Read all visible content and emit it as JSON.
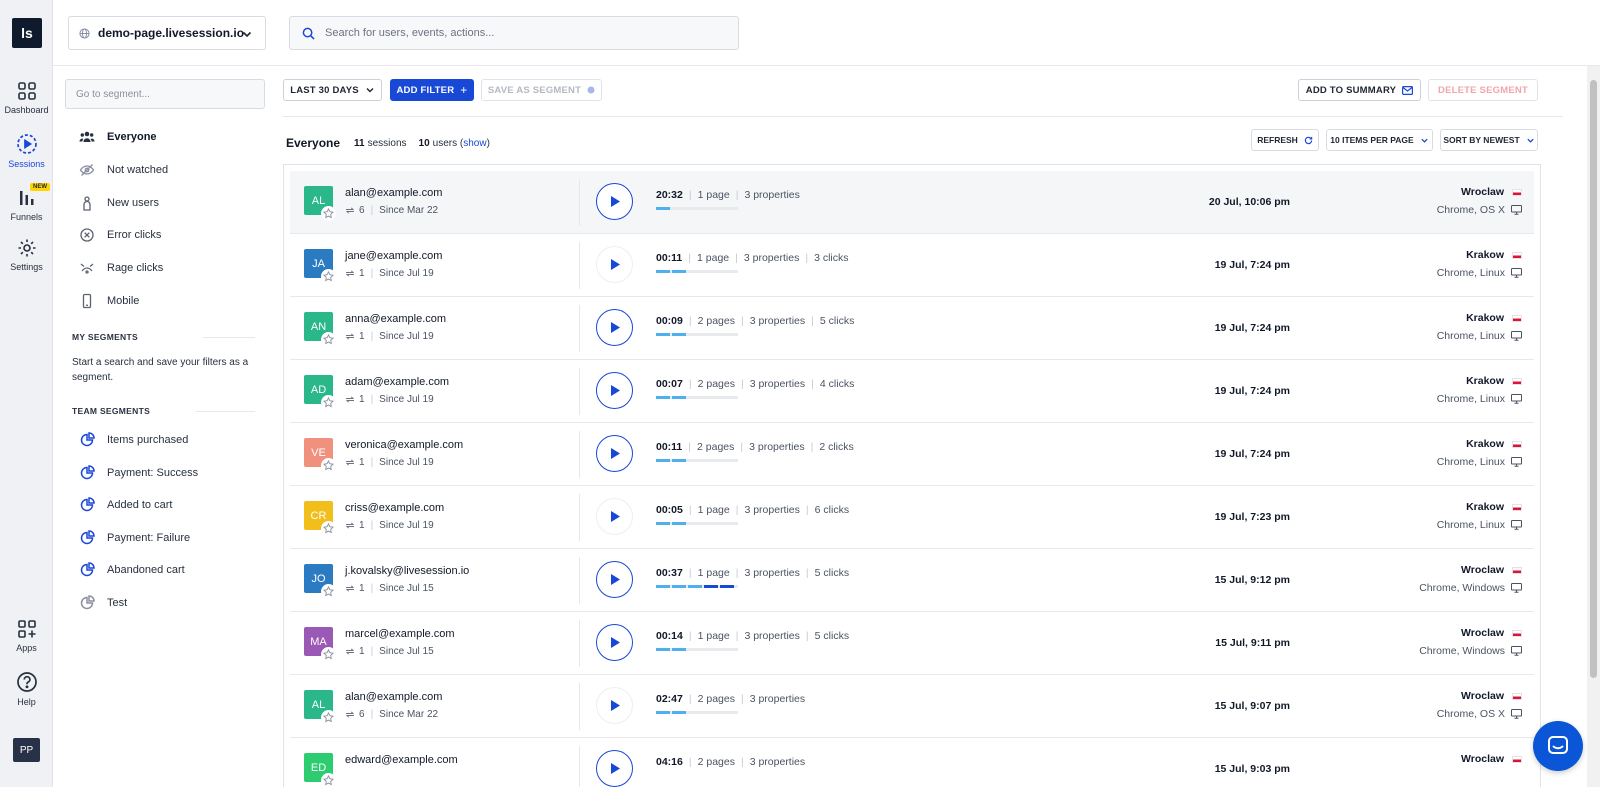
{
  "app": {
    "logo": "ls",
    "avatar_initials": "PP"
  },
  "rail": [
    {
      "label": "Dashboard",
      "icon": "grid-icon"
    },
    {
      "label": "Sessions",
      "icon": "play-circle-icon",
      "active": true
    },
    {
      "label": "Funnels",
      "icon": "bar-chart-icon",
      "badge": "NEW"
    },
    {
      "label": "Settings",
      "icon": "gear-icon"
    },
    {
      "label": "Apps",
      "icon": "apps-plus-icon"
    },
    {
      "label": "Help",
      "icon": "help-icon"
    }
  ],
  "header": {
    "site": "demo-page.livesession.io",
    "search_placeholder": "Search for users, events, actions..."
  },
  "segments": {
    "search_placeholder": "Go to segment...",
    "default": [
      {
        "label": "Everyone",
        "icon": "users-icon"
      },
      {
        "label": "Not watched",
        "icon": "eye-off-icon"
      },
      {
        "label": "New users",
        "icon": "new-user-icon"
      },
      {
        "label": "Error clicks",
        "icon": "error-icon"
      },
      {
        "label": "Rage clicks",
        "icon": "rage-icon"
      },
      {
        "label": "Mobile",
        "icon": "mobile-icon"
      }
    ],
    "my_title": "MY SEGMENTS",
    "my_empty": "Start a search and save your filters as a segment.",
    "team_title": "TEAM SEGMENTS",
    "team": [
      {
        "label": "Items purchased"
      },
      {
        "label": "Payment: Success"
      },
      {
        "label": "Added to cart"
      },
      {
        "label": "Payment: Failure"
      },
      {
        "label": "Abandoned cart"
      },
      {
        "label": "Test"
      }
    ]
  },
  "toolbar": {
    "range": "LAST 30 DAYS",
    "add_filter": "ADD FILTER",
    "save_segment": "SAVE AS SEGMENT",
    "add_summary": "ADD TO SUMMARY",
    "delete_segment": "DELETE SEGMENT"
  },
  "list": {
    "segment": "Everyone",
    "sessions_count": "11",
    "sessions_label": "sessions",
    "users_count": "10",
    "users_label": "users",
    "show": "show",
    "refresh": "REFRESH",
    "per_page": "10 ITEMS PER PAGE",
    "sort": "SORT BY NEWEST"
  },
  "colors": {
    "accent": "#1748d6",
    "progress": "#4fb0f0"
  },
  "sessions": [
    {
      "initials": "AL",
      "color": "#2ab78a",
      "email": "alan@example.com",
      "visits": "6",
      "since": "Since Mar 22",
      "duration": "20:32",
      "pages": "1 page",
      "props": "3 properties",
      "clicks": "",
      "bar": 1,
      "bar_dark": 0,
      "date": "20 Jul, 10:06 pm",
      "city": "Wroclaw",
      "env": "Chrome, OS X",
      "highlight": true
    },
    {
      "initials": "JA",
      "color": "#2b7bc3",
      "email": "jane@example.com",
      "visits": "1",
      "since": "Since Jul 19",
      "duration": "00:11",
      "pages": "1 page",
      "props": "3 properties",
      "clicks": "3 clicks",
      "bar": 2,
      "bar_dark": 0,
      "date": "19 Jul, 7:24 pm",
      "city": "Krakow",
      "env": "Chrome, Linux",
      "light": true
    },
    {
      "initials": "AN",
      "color": "#2ab78a",
      "email": "anna@example.com",
      "visits": "1",
      "since": "Since Jul 19",
      "duration": "00:09",
      "pages": "2 pages",
      "props": "3 properties",
      "clicks": "5 clicks",
      "bar": 2,
      "bar_dark": 0,
      "date": "19 Jul, 7:24 pm",
      "city": "Krakow",
      "env": "Chrome, Linux"
    },
    {
      "initials": "AD",
      "color": "#2ab78a",
      "email": "adam@example.com",
      "visits": "1",
      "since": "Since Jul 19",
      "duration": "00:07",
      "pages": "2 pages",
      "props": "3 properties",
      "clicks": "4 clicks",
      "bar": 2,
      "bar_dark": 0,
      "date": "19 Jul, 7:24 pm",
      "city": "Krakow",
      "env": "Chrome, Linux"
    },
    {
      "initials": "VE",
      "color": "#f0917e",
      "email": "veronica@example.com",
      "visits": "1",
      "since": "Since Jul 19",
      "duration": "00:11",
      "pages": "2 pages",
      "props": "3 properties",
      "clicks": "2 clicks",
      "bar": 2,
      "bar_dark": 0,
      "date": "19 Jul, 7:24 pm",
      "city": "Krakow",
      "env": "Chrome, Linux"
    },
    {
      "initials": "CR",
      "color": "#f2be1c",
      "email": "criss@example.com",
      "visits": "1",
      "since": "Since Jul 19",
      "duration": "00:05",
      "pages": "1 page",
      "props": "3 properties",
      "clicks": "6 clicks",
      "bar": 2,
      "bar_dark": 0,
      "date": "19 Jul, 7:23 pm",
      "city": "Krakow",
      "env": "Chrome, Linux",
      "light": true
    },
    {
      "initials": "JO",
      "color": "#2b7bc3",
      "email": "j.kovalsky@livesession.io",
      "visits": "1",
      "since": "Since Jul 15",
      "duration": "00:37",
      "pages": "1 page",
      "props": "3 properties",
      "clicks": "5 clicks",
      "bar": 3,
      "bar_dark": 2,
      "date": "15 Jul, 9:12 pm",
      "city": "Wroclaw",
      "env": "Chrome, Windows"
    },
    {
      "initials": "MA",
      "color": "#9b59b6",
      "email": "marcel@example.com",
      "visits": "1",
      "since": "Since Jul 15",
      "duration": "00:14",
      "pages": "1 page",
      "props": "3 properties",
      "clicks": "5 clicks",
      "bar": 2,
      "bar_dark": 0,
      "date": "15 Jul, 9:11 pm",
      "city": "Wroclaw",
      "env": "Chrome, Windows"
    },
    {
      "initials": "AL",
      "color": "#2ab78a",
      "email": "alan@example.com",
      "visits": "6",
      "since": "Since Mar 22",
      "duration": "02:47",
      "pages": "2 pages",
      "props": "3 properties",
      "clicks": "",
      "bar": 2,
      "bar_dark": 0,
      "date": "15 Jul, 9:07 pm",
      "city": "Wroclaw",
      "env": "Chrome, OS X",
      "light": true
    },
    {
      "initials": "ED",
      "color": "#2ecc71",
      "email": "edward@example.com",
      "visits": "",
      "since": "",
      "duration": "04:16",
      "pages": "2 pages",
      "props": "3 properties",
      "clicks": "",
      "bar": 0,
      "bar_dark": 0,
      "date": "15 Jul, 9:03 pm",
      "city": "Wroclaw",
      "env": ""
    }
  ]
}
